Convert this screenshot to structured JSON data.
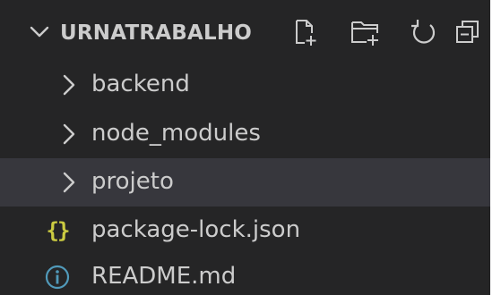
{
  "explorer": {
    "title": "URNATRABALHO",
    "toolbar": {
      "new_file_icon": "new-file-icon",
      "new_folder_icon": "new-folder-icon",
      "refresh_icon": "refresh-icon",
      "collapse_icon": "collapse-all-icon"
    },
    "items": [
      {
        "label": "backend",
        "kind": "folder",
        "icon": "chevron-right-icon"
      },
      {
        "label": "node_modules",
        "kind": "folder",
        "icon": "chevron-right-icon"
      },
      {
        "label": "projeto",
        "kind": "folder",
        "icon": "chevron-right-icon",
        "selected": true
      },
      {
        "label": "package-lock.json",
        "kind": "file",
        "icon": "json-icon",
        "icon_text": "{}"
      },
      {
        "label": "README.md",
        "kind": "file",
        "icon": "info-icon"
      }
    ]
  },
  "colors": {
    "background": "#252526",
    "selected_row": "#37373d",
    "text": "#cccccc",
    "json_icon": "#cbcb41",
    "info_icon": "#519aba"
  }
}
